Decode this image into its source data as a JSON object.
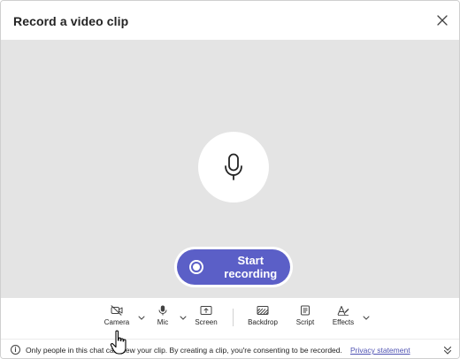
{
  "dialog": {
    "title": "Record a video clip",
    "close_icon": "close-icon"
  },
  "stage": {
    "mic_icon": "microphone-icon",
    "record_label": "Start recording"
  },
  "toolbar": {
    "camera_label": "Camera",
    "mic_label": "Mic",
    "screen_label": "Screen",
    "backdrop_label": "Backdrop",
    "script_label": "Script",
    "effects_label": "Effects"
  },
  "footer": {
    "notice_text": "Only people in this chat can view your clip. By creating a clip, you're consenting to be recorded.",
    "privacy_link": "Privacy statement"
  },
  "colors": {
    "accent": "#5b5fc7",
    "stage_bg": "#e4e4e4",
    "link": "#4f52b2"
  }
}
